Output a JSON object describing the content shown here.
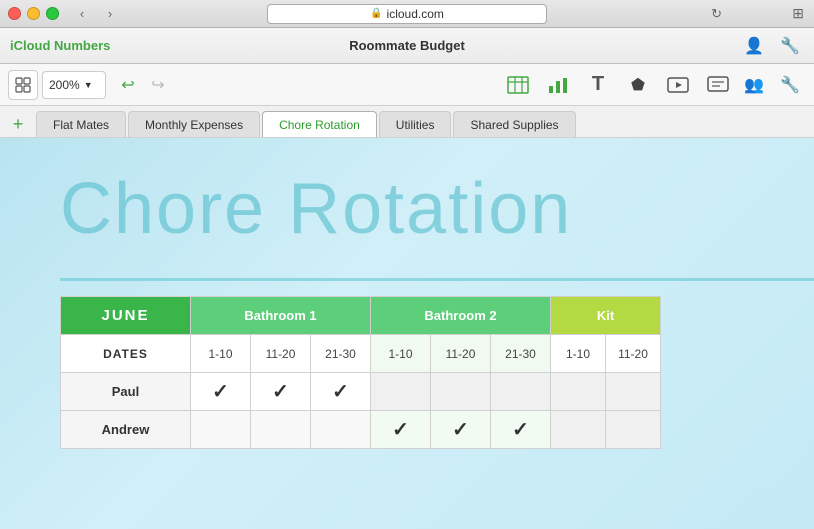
{
  "window": {
    "url": "icloud.com",
    "title": "Roommate Budget",
    "app_name": "iCloud",
    "app_name_colored": "Numbers"
  },
  "toolbar": {
    "zoom": "200%",
    "undo_label": "↩",
    "redo_label": "↪"
  },
  "tabs": [
    {
      "id": "flat-mates",
      "label": "Flat Mates",
      "active": false
    },
    {
      "id": "monthly-expenses",
      "label": "Monthly Expenses",
      "active": false
    },
    {
      "id": "chore-rotation",
      "label": "Chore Rotation",
      "active": true
    },
    {
      "id": "utilities",
      "label": "Utilities",
      "active": false
    },
    {
      "id": "shared-supplies",
      "label": "Shared Supplies",
      "active": false
    }
  ],
  "content": {
    "page_title": "Chore Rotation",
    "table": {
      "month": "JUNE",
      "columns": [
        "Bathroom 1",
        "Bathroom 2",
        "Kit"
      ],
      "sub_cols": [
        "1-10",
        "11-20",
        "21-30"
      ],
      "dates_label": "DATES",
      "rows": [
        {
          "name": "Paul",
          "bathroom1": [
            "check",
            "check",
            "check"
          ],
          "bathroom2": [
            "empty",
            "empty",
            "empty"
          ],
          "kitchen": [
            "empty"
          ]
        },
        {
          "name": "Andrew",
          "bathroom1": [
            "empty",
            "empty",
            "empty"
          ],
          "bathroom2": [
            "check",
            "check",
            "check"
          ],
          "kitchen": [
            "empty"
          ]
        }
      ]
    }
  }
}
